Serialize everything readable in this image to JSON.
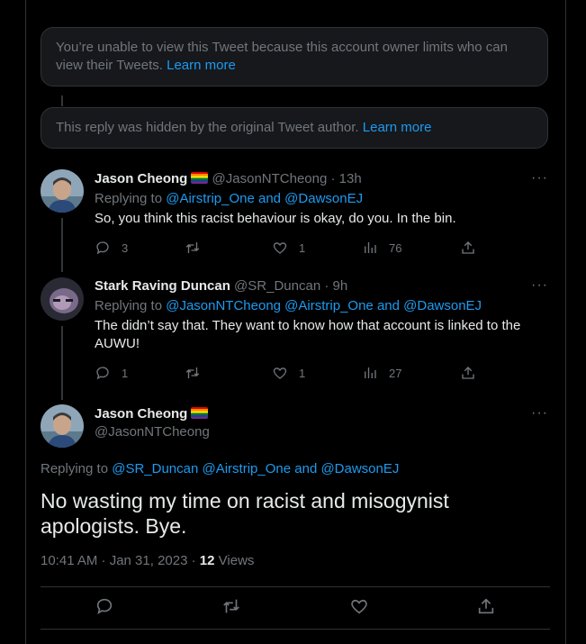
{
  "notices": {
    "restricted_text": "You’re unable to view this Tweet because this account owner limits who can view their Tweets.",
    "restricted_link": "Learn more",
    "hidden_text": "This reply was hidden by the original Tweet author.",
    "hidden_link": "Learn more"
  },
  "replies": [
    {
      "name": "Jason Cheong",
      "handle": "@JasonNTCheong",
      "time": "· 13h",
      "replying_prefix": "Replying to",
      "replying_to": "@Airstrip_One and @DawsonEJ",
      "text": "So, you think this racist behaviour is okay, do you. In the bin.",
      "replies": "3",
      "retweets": "",
      "likes": "1",
      "views": "76"
    },
    {
      "name": "Stark Raving Duncan",
      "handle": "@SR_Duncan",
      "time": "· 9h",
      "replying_prefix": "Replying to",
      "replying_to": "@JasonNTCheong @Airstrip_One and @DawsonEJ",
      "text": "The didn’t say that. They want to know how that account is linked to the AUWU!",
      "replies": "1",
      "retweets": "",
      "likes": "1",
      "views": "27"
    }
  ],
  "main_tweet": {
    "name": "Jason Cheong",
    "handle": "@JasonNTCheong",
    "replying_prefix": "Replying to",
    "replying_to": "@SR_Duncan @Airstrip_One and @DawsonEJ",
    "text": "No wasting my time on racist and misogynist apologists. Bye.",
    "timestamp": "10:41 AM · Jan 31, 2023 ·",
    "views_count": "12",
    "views_label": "Views"
  },
  "more_glyph": "···",
  "colors": {
    "background": "#000000",
    "link": "#1d9bf0",
    "muted": "#71767b",
    "text": "#e7e9ea",
    "card": "#16181c"
  },
  "icons": [
    "reply-icon",
    "retweet-icon",
    "like-icon",
    "views-icon",
    "share-icon",
    "more-icon",
    "rainbow-flag-icon"
  ]
}
